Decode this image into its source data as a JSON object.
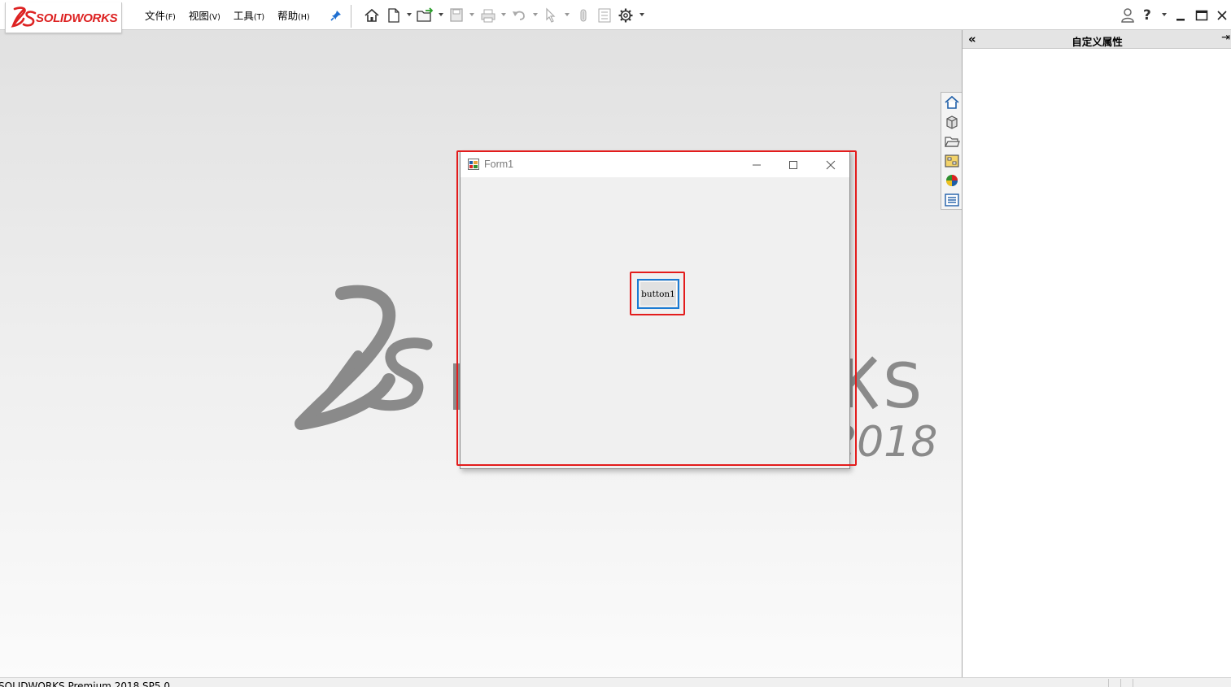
{
  "app": {
    "logo_text": "SOLIDWORKS",
    "brand_color": "#d22222",
    "status_text": "SOLIDWORKS Premium 2018 SP5.0"
  },
  "menu": {
    "items": [
      {
        "label": "文件",
        "accel": "(F)"
      },
      {
        "label": "视图",
        "accel": "(V)"
      },
      {
        "label": "工具",
        "accel": "(T)"
      },
      {
        "label": "帮助",
        "accel": "(H)"
      }
    ]
  },
  "toolbar": {
    "icons": [
      "home-icon",
      "new-document-icon",
      "open-icon",
      "save-icon",
      "print-icon",
      "undo-icon",
      "select-icon",
      "rebuild-icon",
      "file-properties-icon",
      "options-gear-icon"
    ]
  },
  "window_controls": {
    "icons": [
      "user-icon",
      "help-icon",
      "minimize-icon",
      "maximize-icon",
      "close-icon"
    ]
  },
  "taskpane": {
    "title": "自定义属性",
    "tabs": [
      "home-tab-icon",
      "3d-content-icon",
      "file-explorer-icon",
      "view-palette-icon",
      "appearances-icon",
      "custom-properties-icon"
    ]
  },
  "watermark": {
    "brand": "SOLIDWORKS",
    "year": "2018"
  },
  "form1": {
    "title": "Form1",
    "button_label": "button1"
  },
  "highlight_color": "#e31c1c"
}
